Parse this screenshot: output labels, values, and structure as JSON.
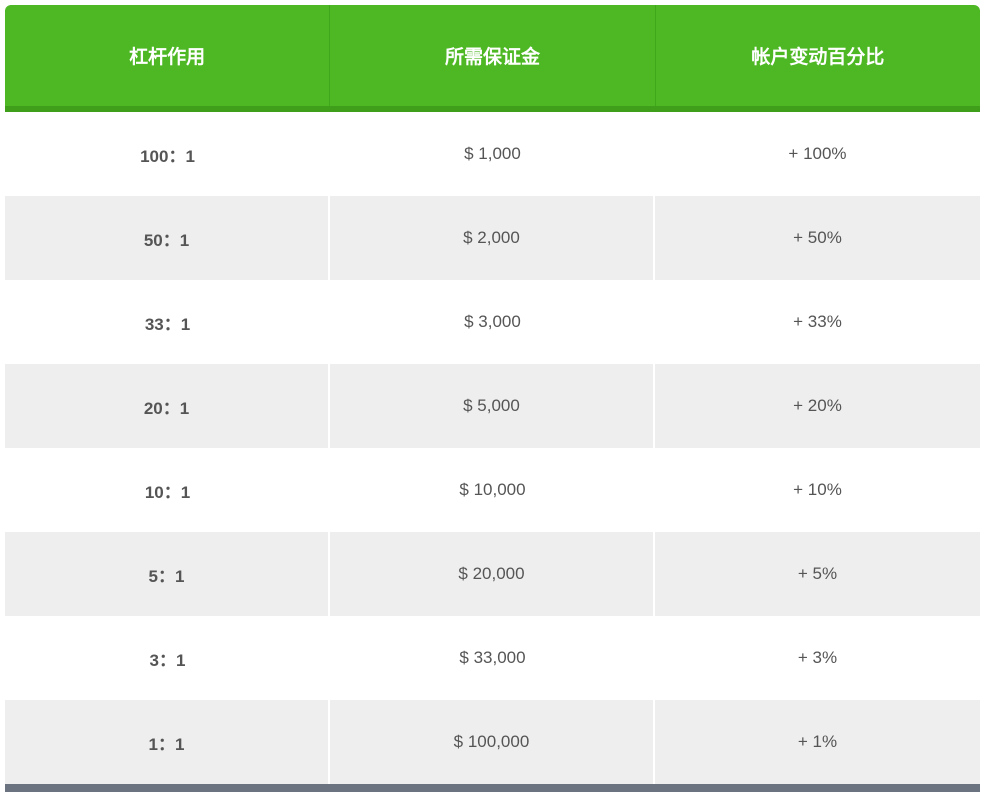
{
  "table": {
    "headers": [
      "杠杆作用",
      "所需保证金",
      "帐户变动百分比"
    ],
    "rows": [
      {
        "leverage": "100：1",
        "margin": "$ 1,000",
        "change": "+ 100%"
      },
      {
        "leverage": "50：1",
        "margin": "$ 2,000",
        "change": "+ 50%"
      },
      {
        "leverage": "33：1",
        "margin": "$ 3,000",
        "change": "+ 33%"
      },
      {
        "leverage": "20：1",
        "margin": "$ 5,000",
        "change": "+ 20%"
      },
      {
        "leverage": "10：1",
        "margin": "$ 10,000",
        "change": "+ 10%"
      },
      {
        "leverage": "5：1",
        "margin": "$ 20,000",
        "change": "+ 5%"
      },
      {
        "leverage": "3：1",
        "margin": "$ 33,000",
        "change": "+ 3%"
      },
      {
        "leverage": "1：1",
        "margin": "$ 100,000",
        "change": "+ 1%"
      }
    ]
  },
  "colors": {
    "header_bg": "#4db823",
    "header_underline": "#3f9f1a",
    "alt_row_bg": "#eeeeee",
    "footer_bar": "#6b7280"
  }
}
